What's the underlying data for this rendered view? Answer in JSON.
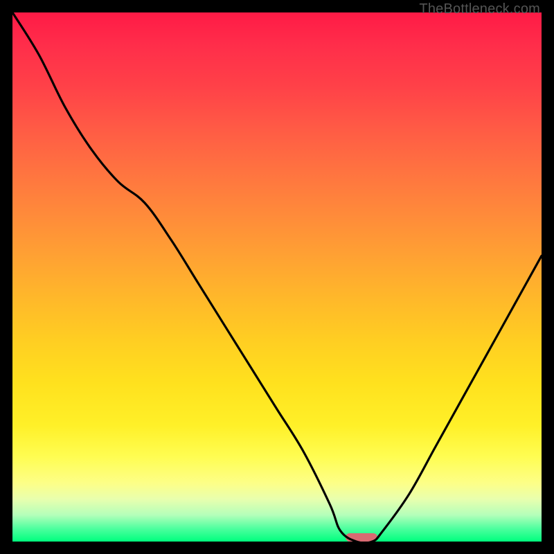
{
  "watermark": "TheBottleneck.com",
  "chart_data": {
    "type": "line",
    "title": "",
    "xlabel": "",
    "ylabel": "",
    "xlim": [
      0,
      100
    ],
    "ylim": [
      0,
      100
    ],
    "grid": false,
    "legend": false,
    "series": [
      {
        "name": "bottleneck-curve",
        "x": [
          0,
          5,
          10,
          15,
          20,
          25,
          30,
          35,
          40,
          45,
          50,
          55,
          60,
          62,
          65,
          68,
          70,
          75,
          80,
          85,
          90,
          95,
          100
        ],
        "y": [
          100,
          92,
          82,
          74,
          68,
          64,
          57,
          49,
          41,
          33,
          25,
          17,
          7,
          2,
          0,
          0,
          2,
          9,
          18,
          27,
          36,
          45,
          54
        ]
      }
    ],
    "marker": {
      "name": "optimal-range",
      "x_center": 66,
      "y": 0,
      "width_pct": 6,
      "color": "#d96a72"
    },
    "background_gradient": {
      "top": "#ff1a46",
      "mid": "#ffce22",
      "bottom": "#00ff7e"
    }
  }
}
